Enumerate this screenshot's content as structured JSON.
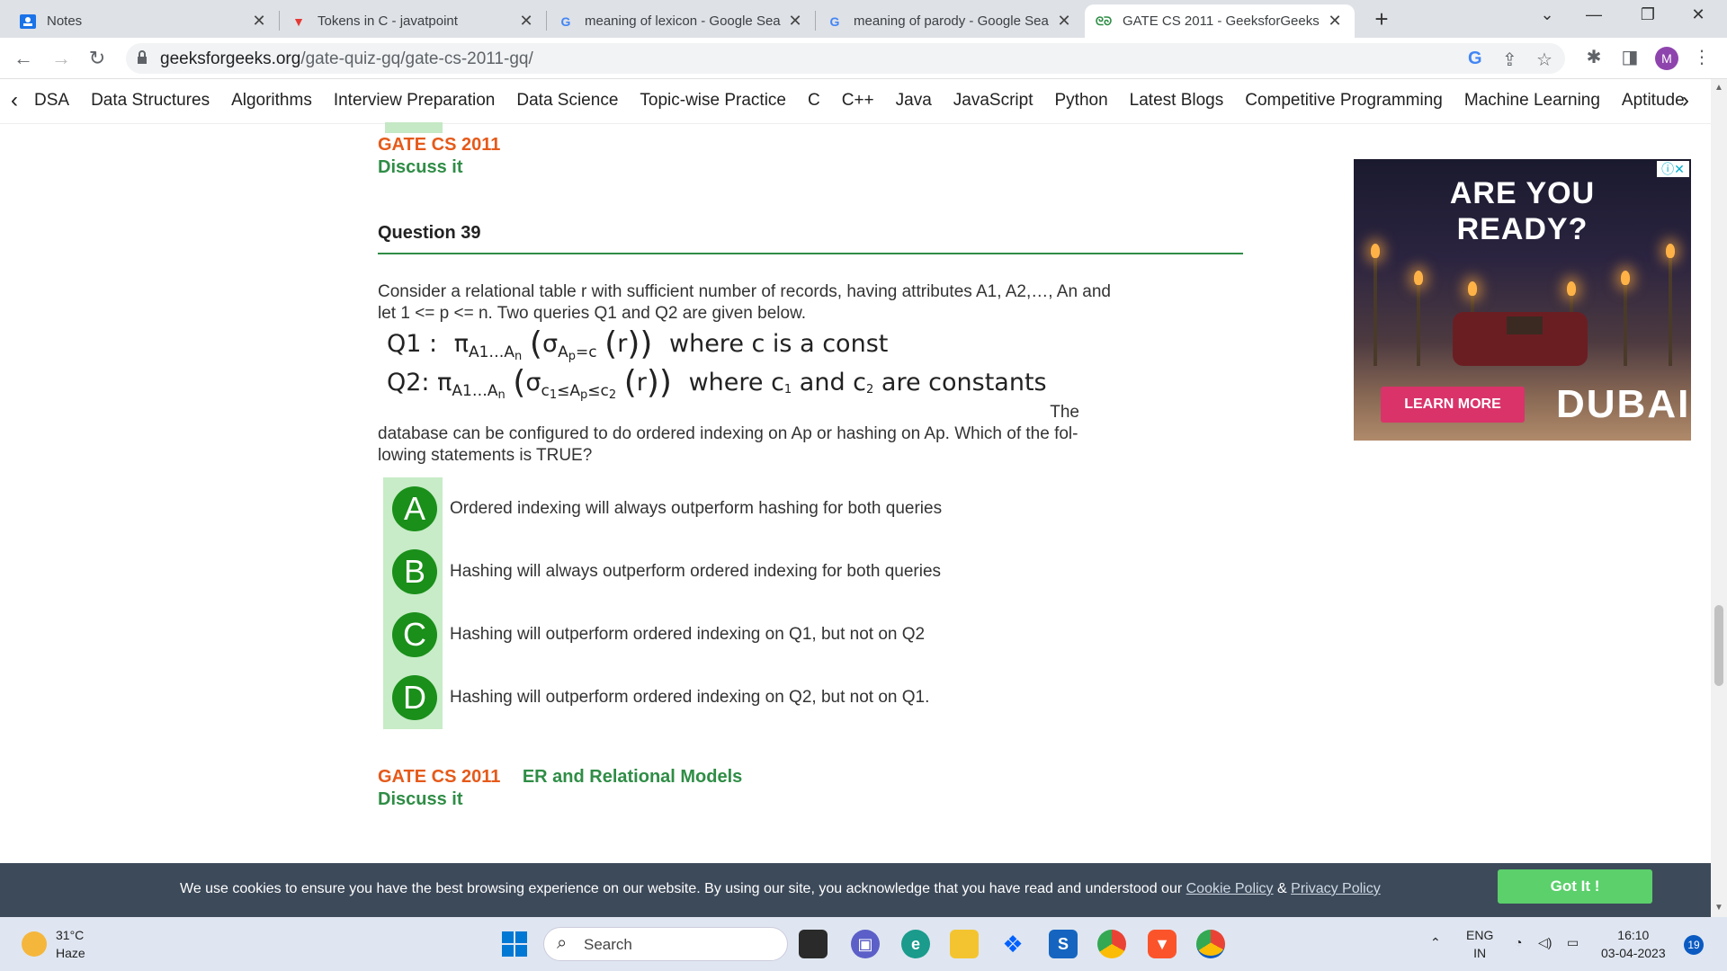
{
  "browser": {
    "tabs": [
      {
        "title": "Notes",
        "favicon": "notes-icon",
        "color": "#1a73e8"
      },
      {
        "title": "Tokens in C - javatpoint",
        "favicon": "javatpoint-icon",
        "color": "#e53935"
      },
      {
        "title": "meaning of lexicon - Google Sea",
        "favicon": "google-icon",
        "color": "#4285f4"
      },
      {
        "title": "meaning of parody - Google Sea",
        "favicon": "google-icon",
        "color": "#4285f4"
      },
      {
        "title": "GATE CS 2011 - GeeksforGeeks",
        "favicon": "gfg-icon",
        "color": "#2f8d46"
      }
    ],
    "url_host": "geeksforgeeks.org",
    "url_path": "/gate-quiz-gq/gate-cs-2011-gq/",
    "profile_initial": "M"
  },
  "sitenav": {
    "items": [
      "DSA",
      "Data Structures",
      "Algorithms",
      "Interview Preparation",
      "Data Science",
      "Topic-wise Practice",
      "C",
      "C++",
      "Java",
      "JavaScript",
      "Python",
      "Latest Blogs",
      "Competitive Programming",
      "Machine Learning",
      "Aptitude"
    ]
  },
  "prev_question": {
    "tag": "GATE CS 2011",
    "discuss": "Discuss it"
  },
  "question": {
    "title": "Question 39",
    "text_intro": "Consider a relational table r with sufficient number of records, having attributes A1, A2,…, An and let 1 <= p <= n. Two queries Q1 and Q2 are given below.",
    "q1_label": "Q1 :",
    "q1_where": "where c is a const",
    "q2_label": "Q2:",
    "q2_where": "where c",
    "q2_and": "and c",
    "q2_end": "are constants",
    "text_the": "The",
    "text_outro": "database can be configured to do ordered indexing on Ap or hashing on Ap. Which of the fol­lowing statements is TRUE?",
    "options": [
      {
        "letter": "A",
        "text": "Ordered indexing will always outperform hashing for both queries"
      },
      {
        "letter": "B",
        "text": "Hashing will always outperform ordered indexing for both queries"
      },
      {
        "letter": "C",
        "text": "Hashing will outperform ordered indexing on Q1, but not on Q2"
      },
      {
        "letter": "D",
        "text": "Hashing will outperform ordered indexing on Q2, but not on Q1."
      }
    ],
    "tag": "GATE CS 2011",
    "topic": "ER and Relational Models",
    "discuss": "Discuss it"
  },
  "ad": {
    "headline_1": "ARE YOU",
    "headline_2": "READY?",
    "cta": "LEARN MORE",
    "brand": "DUBAI"
  },
  "cookie": {
    "message": "We use cookies to ensure you have the best browsing experience on our website. By using our site, you acknowledge that you have read and understood our",
    "cookie_policy": "Cookie Policy",
    "amp": "&",
    "privacy_policy": "Privacy Policy",
    "button": "Got It !"
  },
  "taskbar": {
    "temp": "31°C",
    "weather": "Haze",
    "search_placeholder": "Search",
    "lang_1": "ENG",
    "lang_2": "IN",
    "time": "16:10",
    "date": "03-04-2023",
    "notif_count": "19"
  }
}
